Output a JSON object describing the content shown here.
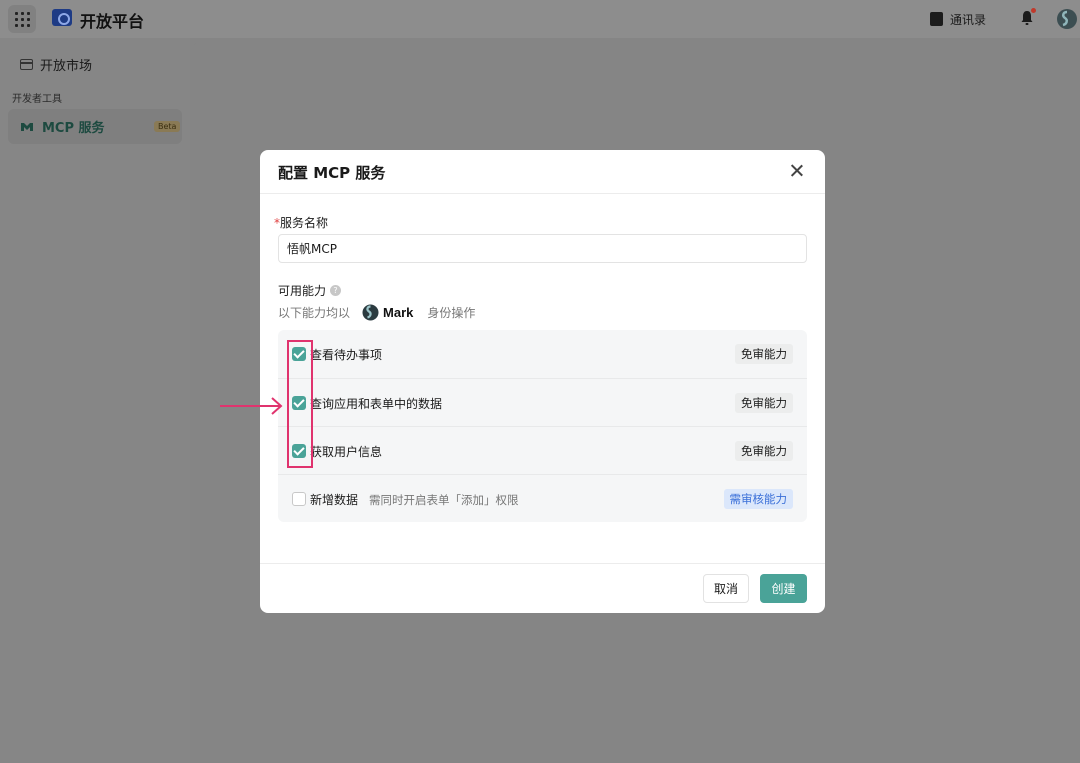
{
  "topbar": {
    "brand_name": "开放平台",
    "contacts_label": "通讯录"
  },
  "sidebar": {
    "market_label": "开放市场",
    "section_title": "开发者工具",
    "mcp_label": "MCP 服务",
    "mcp_badge": "Beta"
  },
  "modal": {
    "title": "配置 MCP 服务",
    "name_field": {
      "required_mark": "*",
      "label": "服务名称",
      "value": "悟帆MCP"
    },
    "capabilities": {
      "label": "可用能力",
      "identity_prefix": "以下能力均以",
      "identity_name": "Mark",
      "identity_suffix": "身份操作",
      "items": [
        {
          "name": "查看待办事项",
          "checked": true,
          "note": "",
          "tag": "免审能力"
        },
        {
          "name": "查询应用和表单中的数据",
          "checked": true,
          "note": "",
          "tag": "免审能力"
        },
        {
          "name": "获取用户信息",
          "checked": true,
          "note": "",
          "tag": "免审能力"
        },
        {
          "name": "新增数据",
          "checked": false,
          "note": "需同时开启表单「添加」权限",
          "tag": "需审核能力"
        }
      ]
    },
    "cancel_label": "取消",
    "create_label": "创建"
  },
  "colors": {
    "accent": "#4aa398",
    "annotation": "#e0336e",
    "review_tag": "#3a6fd8"
  },
  "icons": [
    "apps-grid-icon",
    "brand-logo-icon",
    "contacts-icon",
    "bell-icon",
    "avatar-icon",
    "market-icon",
    "mcp-icon",
    "close-icon",
    "help-icon",
    "mark-logo-icon",
    "checkbox-icon",
    "arrow-right-icon"
  ]
}
